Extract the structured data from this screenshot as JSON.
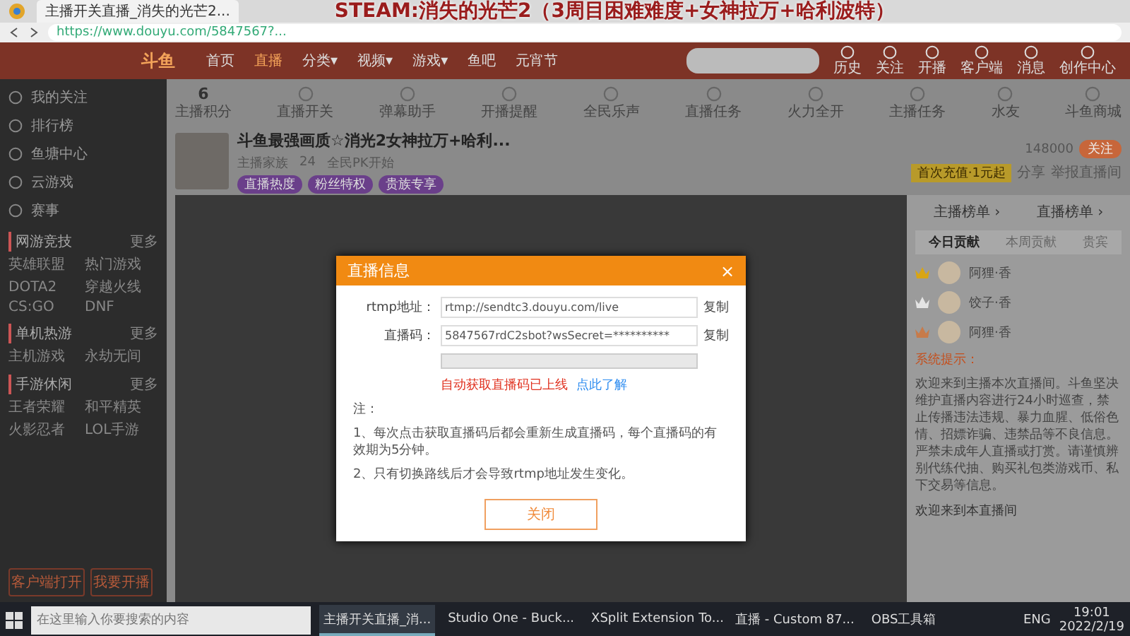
{
  "browser": {
    "tab_title": "主播开关直播_消失的光芒2...",
    "overlay_title": "STEAM:消失的光芒2（3周目困难难度+女神拉万+哈利波特）",
    "url": "https://www.douyu.com/5847567?..."
  },
  "header": {
    "logo": "斗鱼",
    "nav": [
      {
        "label": "首页",
        "selected": false
      },
      {
        "label": "直播",
        "selected": true
      },
      {
        "label": "分类▾",
        "selected": false
      },
      {
        "label": "视频▾",
        "selected": false
      },
      {
        "label": "游戏▾",
        "selected": false
      },
      {
        "label": "鱼吧",
        "selected": false
      },
      {
        "label": "元宵节",
        "selected": false
      }
    ],
    "actions": [
      "历史",
      "关注",
      "开播",
      "客户端",
      "消息",
      "创作中心"
    ]
  },
  "sidebar": {
    "menu": [
      "我的关注",
      "排行榜",
      "鱼塘中心",
      "云游戏",
      "赛事"
    ],
    "sections": [
      {
        "title": "网游竞技",
        "more": "更多",
        "items": [
          "英雄联盟",
          "热门游戏",
          "DOTA2",
          "穿越火线",
          "CS:GO",
          "DNF"
        ]
      },
      {
        "title": "单机热游",
        "more": "更多",
        "items": [
          "主机游戏",
          "永劫无间"
        ]
      },
      {
        "title": "手游休闲",
        "more": "更多",
        "items": [
          "王者荣耀",
          "和平精英",
          "火影忍者",
          "LOL手游"
        ]
      }
    ],
    "bottom": [
      "客户端打开",
      "我要开播"
    ]
  },
  "toolbar": [
    {
      "label": "主播积分",
      "count": "6"
    },
    {
      "label": "直播开关"
    },
    {
      "label": "弹幕助手"
    },
    {
      "label": "开播提醒"
    },
    {
      "label": "全民乐声"
    },
    {
      "label": "直播任务"
    },
    {
      "label": "火力全开"
    },
    {
      "label": "主播任务"
    },
    {
      "label": "水友"
    },
    {
      "label": "斗鱼商城"
    }
  ],
  "streamer": {
    "title": "斗鱼最强画质☆消光2女神拉万+哈利...",
    "meta": [
      "主播家族",
      "24",
      "全民PK开始"
    ],
    "tags": [
      "直播热度",
      "粉丝特权",
      "贵族专享"
    ],
    "followers": "148000",
    "follow": "关注",
    "recharge": "首次充值·1元起",
    "share": "分享",
    "report": "举报直播间"
  },
  "dialog": {
    "title": "直播信息",
    "close": "×",
    "fields": [
      {
        "label": "rtmp地址：",
        "value": "rtmp://sendtc3.douyu.com/live",
        "copy": "复制"
      },
      {
        "label": "直播码：",
        "value": "5847567rdC2sbot?wsSecret=**********",
        "copy": "复制"
      }
    ],
    "warning": "自动获取直播码已上线",
    "learn_more": "点此了解",
    "notes": [
      "注：",
      "1、每次点击获取直播码后都会重新生成直播码，每个直播码的有效期为5分钟。",
      "2、只有切换路线后才会导致rtmp地址发生变化。"
    ],
    "button": "关闭"
  },
  "right_panel": {
    "rank_links": [
      "主播榜单 ›",
      "直播榜单 ›"
    ],
    "tabs": [
      {
        "label": "今日贡献",
        "selected": true
      },
      {
        "label": "本周贡献",
        "selected": false
      },
      {
        "label": "贵宾",
        "selected": false
      }
    ],
    "users": [
      {
        "name": "阿狸·香",
        "color": "#d9a514"
      },
      {
        "name": "饺子·香",
        "color": "#e4e4e4"
      },
      {
        "name": "阿狸·香",
        "color": "#c77b4a"
      }
    ],
    "system_label": "系统提示：",
    "system_text": "欢迎来到主播本次直播间。斗鱼坚决维护直播内容进行24小时巡查，禁止传播违法违规、暴力血腥、低俗色情、招嫖诈骗、违禁品等不良信息。严禁未成年人直播或打赏。请谨慎辨别代练代抽、购买礼包类游戏币、私下交易等信息。",
    "welcome": "欢迎来到本直播间"
  },
  "taskbar": {
    "search": {
      "placeholder": "在这里输入你要搜索的内容"
    },
    "apps": [
      {
        "label": "主播开关直播_消...",
        "selected": true
      },
      {
        "label": "Studio One - Buck...",
        "selected": false
      },
      {
        "label": "XSplit Extension To...",
        "selected": false
      },
      {
        "label": "直播 - Custom 87...",
        "selected": false
      },
      {
        "label": "OBS工具箱",
        "selected": false
      }
    ],
    "lang": "ENG",
    "time": "19:01",
    "date": "2022/2/19"
  }
}
